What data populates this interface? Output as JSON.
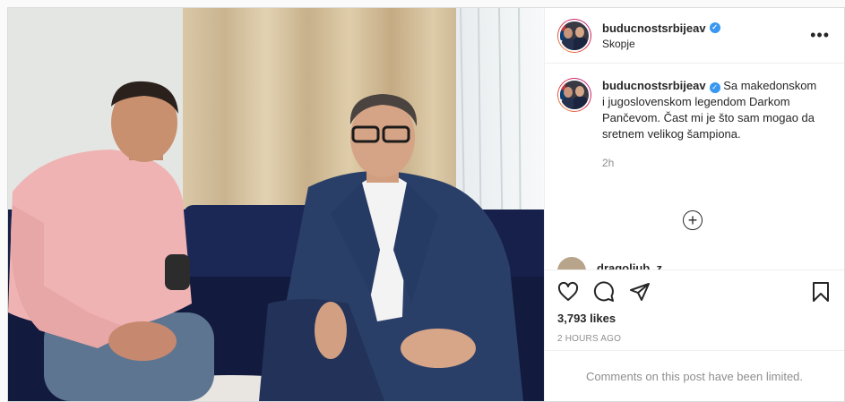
{
  "post": {
    "username": "buducnostsrbijeav",
    "location": "Skopje",
    "verified_icon": "verified-badge-icon",
    "more_icon": "more-options-icon",
    "more_glyph": "•••",
    "caption": {
      "username": "buducnostsrbijeav",
      "text": "Sa makedonskom i jugoslovenskom legendom Darkom Pančevom. Čast mi je što sam mogao da sretnem velikog šampiona.",
      "time": "2h"
    },
    "load_more_icon": "load-more-plus-icon",
    "load_more_glyph": "+",
    "next_comment_user": "dragoljub_z",
    "likes": "3,793 likes",
    "time_ago": "2 HOURS AGO",
    "comments_notice": "Comments on this post have been limited."
  },
  "actions": {
    "like_icon": "heart-icon",
    "comment_icon": "comment-icon",
    "share_icon": "share-icon",
    "save_icon": "bookmark-icon"
  },
  "colors": {
    "verified": "#3897f0",
    "text_primary": "#262626",
    "text_secondary": "#8e8e8e",
    "border": "#dbdbdb"
  }
}
